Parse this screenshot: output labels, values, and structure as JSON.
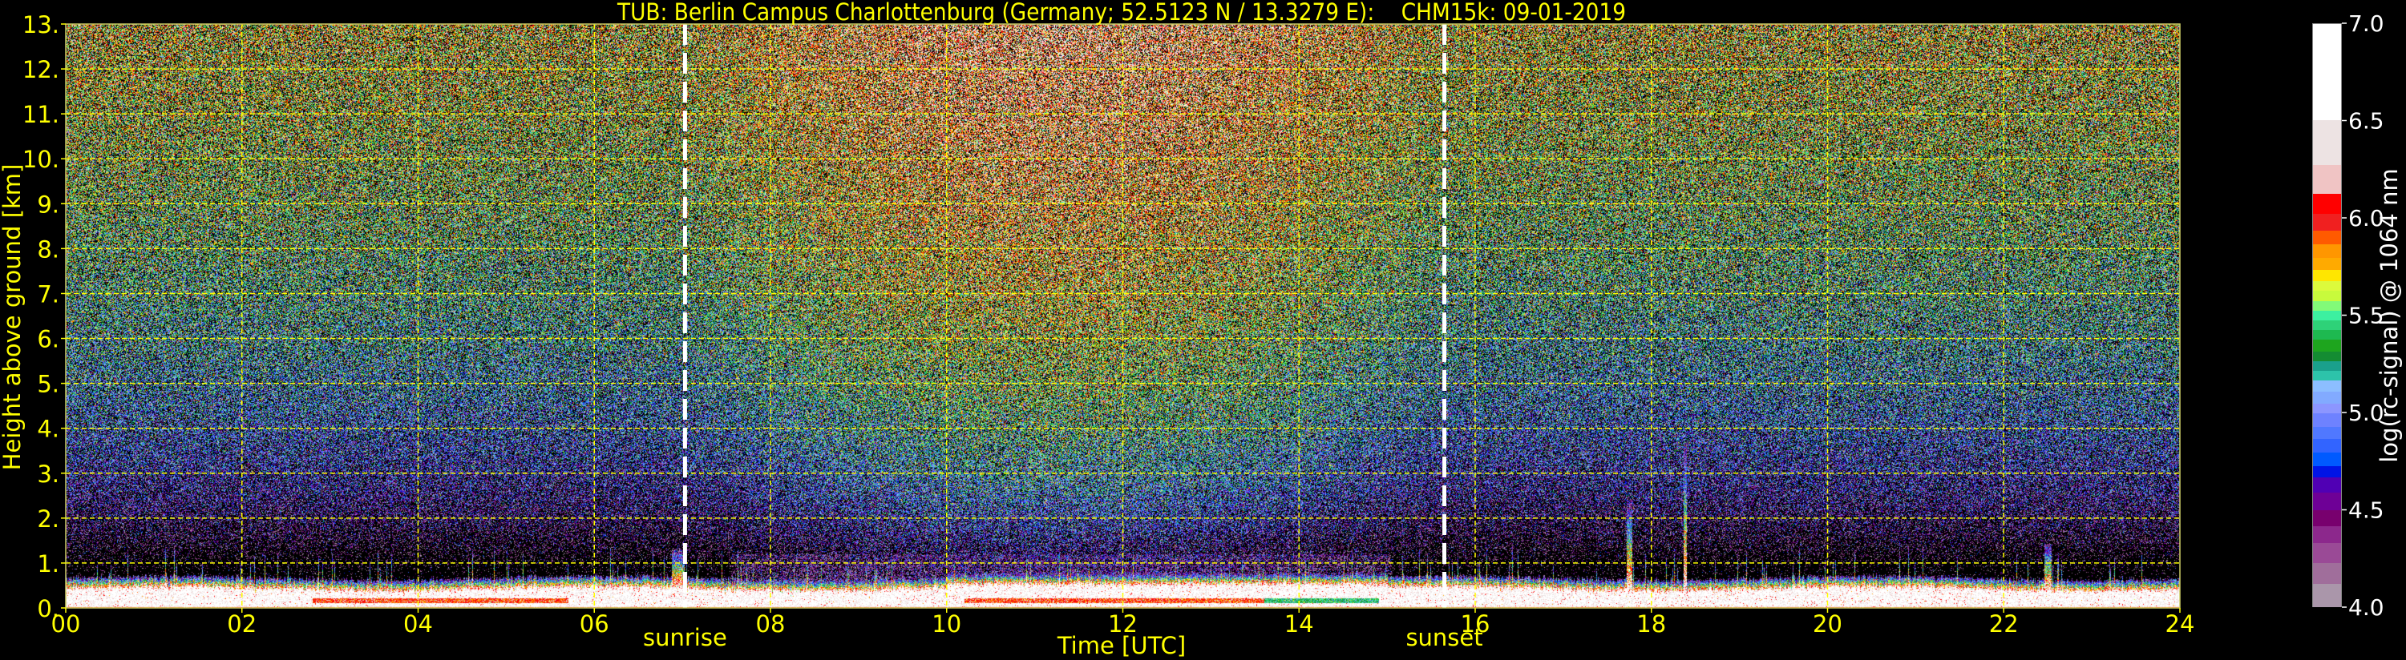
{
  "chart_data": {
    "type": "heatmap",
    "title": "TUB: Berlin Campus Charlottenburg (Germany; 52.5123 N / 13.3279 E):    CHM15k: 09-01-2019",
    "xlabel": "Time [UTC]",
    "ylabel": "Height above ground [km]",
    "xlim": [
      0,
      24
    ],
    "ylim": [
      0,
      13
    ],
    "x_ticks": [
      0,
      2,
      4,
      6,
      8,
      10,
      12,
      14,
      16,
      18,
      20,
      22,
      24
    ],
    "x_tick_labels": [
      "00",
      "02",
      "04",
      "06",
      "08",
      "10",
      "12",
      "14",
      "16",
      "18",
      "20",
      "22",
      "24"
    ],
    "y_ticks": [
      0,
      1,
      2,
      3,
      4,
      5,
      6,
      7,
      8,
      9,
      10,
      11,
      12,
      13
    ],
    "y_tick_labels": [
      "0.",
      "1.",
      "2.",
      "3.",
      "4.",
      "5.",
      "6.",
      "7.",
      "8.",
      "9.",
      "10.",
      "11.",
      "12.",
      "13."
    ],
    "grid": true,
    "grid_color": "#ffff00",
    "text_color": "#ffff00",
    "annotations": [
      {
        "label": "sunrise",
        "x": 7.03
      },
      {
        "label": "sunset",
        "x": 15.65
      }
    ],
    "colorbar": {
      "label": "log(rc-signal) @ 1064 nm",
      "range": [
        4.0,
        7.0
      ],
      "tick_values": [
        4.0,
        4.5,
        5.0,
        5.5,
        6.0,
        6.5,
        7.0
      ],
      "tick_labels": [
        "4.0",
        "4.5",
        "5.0",
        "5.5",
        "6.0",
        "6.5",
        "7.0"
      ],
      "levels": [
        {
          "from": 4.0,
          "color": "#aa96aa"
        },
        {
          "from": 4.12,
          "color": "#a06e9b"
        },
        {
          "from": 4.23,
          "color": "#9a4a96"
        },
        {
          "from": 4.33,
          "color": "#8c288c"
        },
        {
          "from": 4.42,
          "color": "#78006e"
        },
        {
          "from": 4.5,
          "color": "#6e0096"
        },
        {
          "from": 4.59,
          "color": "#5000b4"
        },
        {
          "from": 4.67,
          "color": "#0014e6"
        },
        {
          "from": 4.73,
          "color": "#005aff"
        },
        {
          "from": 4.8,
          "color": "#3264ff"
        },
        {
          "from": 4.87,
          "color": "#5078ff"
        },
        {
          "from": 4.93,
          "color": "#6e82ff"
        },
        {
          "from": 5.0,
          "color": "#8c96ff"
        },
        {
          "from": 5.05,
          "color": "#82aaff"
        },
        {
          "from": 5.11,
          "color": "#8cbeff"
        },
        {
          "from": 5.17,
          "color": "#2dc3aa"
        },
        {
          "from": 5.22,
          "color": "#1aa08c"
        },
        {
          "from": 5.27,
          "color": "#148c32"
        },
        {
          "from": 5.32,
          "color": "#1ea51e"
        },
        {
          "from": 5.38,
          "color": "#1eb950"
        },
        {
          "from": 5.43,
          "color": "#2ed278"
        },
        {
          "from": 5.48,
          "color": "#3cf0a0"
        },
        {
          "from": 5.53,
          "color": "#82fa78"
        },
        {
          "from": 5.58,
          "color": "#c8fa3c"
        },
        {
          "from": 5.63,
          "color": "#dcfa3c"
        },
        {
          "from": 5.68,
          "color": "#ffe600"
        },
        {
          "from": 5.74,
          "color": "#ffaa00"
        },
        {
          "from": 5.8,
          "color": "#ff9600"
        },
        {
          "from": 5.87,
          "color": "#ff5a00"
        },
        {
          "from": 5.94,
          "color": "#f02020"
        },
        {
          "from": 6.03,
          "color": "#ff0000"
        },
        {
          "from": 6.13,
          "color": "#f0c4c4"
        },
        {
          "from": 6.28,
          "color": "#ede3e3"
        },
        {
          "from": 6.51,
          "color": "#ffffff"
        }
      ]
    }
  }
}
